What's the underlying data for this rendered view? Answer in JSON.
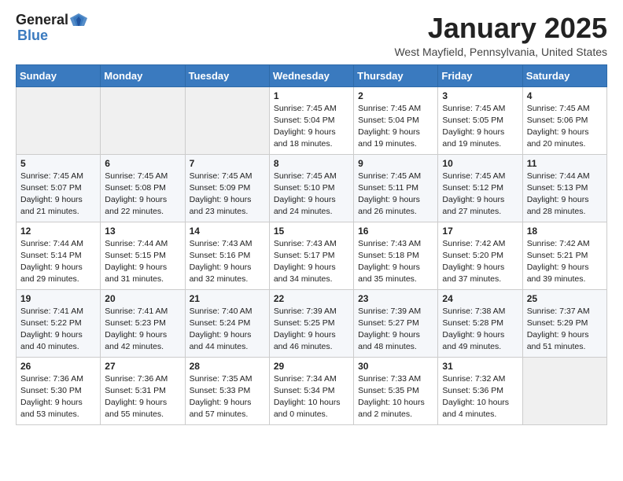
{
  "header": {
    "logo_line1": "General",
    "logo_line2": "Blue",
    "title": "January 2025",
    "subtitle": "West Mayfield, Pennsylvania, United States"
  },
  "weekdays": [
    "Sunday",
    "Monday",
    "Tuesday",
    "Wednesday",
    "Thursday",
    "Friday",
    "Saturday"
  ],
  "weeks": [
    [
      {
        "day": null
      },
      {
        "day": null
      },
      {
        "day": null
      },
      {
        "day": "1",
        "sunrise": "7:45 AM",
        "sunset": "5:04 PM",
        "daylight": "9 hours and 18 minutes."
      },
      {
        "day": "2",
        "sunrise": "7:45 AM",
        "sunset": "5:04 PM",
        "daylight": "9 hours and 19 minutes."
      },
      {
        "day": "3",
        "sunrise": "7:45 AM",
        "sunset": "5:05 PM",
        "daylight": "9 hours and 19 minutes."
      },
      {
        "day": "4",
        "sunrise": "7:45 AM",
        "sunset": "5:06 PM",
        "daylight": "9 hours and 20 minutes."
      }
    ],
    [
      {
        "day": "5",
        "sunrise": "7:45 AM",
        "sunset": "5:07 PM",
        "daylight": "9 hours and 21 minutes."
      },
      {
        "day": "6",
        "sunrise": "7:45 AM",
        "sunset": "5:08 PM",
        "daylight": "9 hours and 22 minutes."
      },
      {
        "day": "7",
        "sunrise": "7:45 AM",
        "sunset": "5:09 PM",
        "daylight": "9 hours and 23 minutes."
      },
      {
        "day": "8",
        "sunrise": "7:45 AM",
        "sunset": "5:10 PM",
        "daylight": "9 hours and 24 minutes."
      },
      {
        "day": "9",
        "sunrise": "7:45 AM",
        "sunset": "5:11 PM",
        "daylight": "9 hours and 26 minutes."
      },
      {
        "day": "10",
        "sunrise": "7:45 AM",
        "sunset": "5:12 PM",
        "daylight": "9 hours and 27 minutes."
      },
      {
        "day": "11",
        "sunrise": "7:44 AM",
        "sunset": "5:13 PM",
        "daylight": "9 hours and 28 minutes."
      }
    ],
    [
      {
        "day": "12",
        "sunrise": "7:44 AM",
        "sunset": "5:14 PM",
        "daylight": "9 hours and 29 minutes."
      },
      {
        "day": "13",
        "sunrise": "7:44 AM",
        "sunset": "5:15 PM",
        "daylight": "9 hours and 31 minutes."
      },
      {
        "day": "14",
        "sunrise": "7:43 AM",
        "sunset": "5:16 PM",
        "daylight": "9 hours and 32 minutes."
      },
      {
        "day": "15",
        "sunrise": "7:43 AM",
        "sunset": "5:17 PM",
        "daylight": "9 hours and 34 minutes."
      },
      {
        "day": "16",
        "sunrise": "7:43 AM",
        "sunset": "5:18 PM",
        "daylight": "9 hours and 35 minutes."
      },
      {
        "day": "17",
        "sunrise": "7:42 AM",
        "sunset": "5:20 PM",
        "daylight": "9 hours and 37 minutes."
      },
      {
        "day": "18",
        "sunrise": "7:42 AM",
        "sunset": "5:21 PM",
        "daylight": "9 hours and 39 minutes."
      }
    ],
    [
      {
        "day": "19",
        "sunrise": "7:41 AM",
        "sunset": "5:22 PM",
        "daylight": "9 hours and 40 minutes."
      },
      {
        "day": "20",
        "sunrise": "7:41 AM",
        "sunset": "5:23 PM",
        "daylight": "9 hours and 42 minutes."
      },
      {
        "day": "21",
        "sunrise": "7:40 AM",
        "sunset": "5:24 PM",
        "daylight": "9 hours and 44 minutes."
      },
      {
        "day": "22",
        "sunrise": "7:39 AM",
        "sunset": "5:25 PM",
        "daylight": "9 hours and 46 minutes."
      },
      {
        "day": "23",
        "sunrise": "7:39 AM",
        "sunset": "5:27 PM",
        "daylight": "9 hours and 48 minutes."
      },
      {
        "day": "24",
        "sunrise": "7:38 AM",
        "sunset": "5:28 PM",
        "daylight": "9 hours and 49 minutes."
      },
      {
        "day": "25",
        "sunrise": "7:37 AM",
        "sunset": "5:29 PM",
        "daylight": "9 hours and 51 minutes."
      }
    ],
    [
      {
        "day": "26",
        "sunrise": "7:36 AM",
        "sunset": "5:30 PM",
        "daylight": "9 hours and 53 minutes."
      },
      {
        "day": "27",
        "sunrise": "7:36 AM",
        "sunset": "5:31 PM",
        "daylight": "9 hours and 55 minutes."
      },
      {
        "day": "28",
        "sunrise": "7:35 AM",
        "sunset": "5:33 PM",
        "daylight": "9 hours and 57 minutes."
      },
      {
        "day": "29",
        "sunrise": "7:34 AM",
        "sunset": "5:34 PM",
        "daylight": "10 hours and 0 minutes."
      },
      {
        "day": "30",
        "sunrise": "7:33 AM",
        "sunset": "5:35 PM",
        "daylight": "10 hours and 2 minutes."
      },
      {
        "day": "31",
        "sunrise": "7:32 AM",
        "sunset": "5:36 PM",
        "daylight": "10 hours and 4 minutes."
      },
      {
        "day": null
      }
    ]
  ],
  "colors": {
    "header_bg": "#3a7abf",
    "header_text": "#ffffff",
    "empty_cell_bg": "#f0f0f0"
  }
}
